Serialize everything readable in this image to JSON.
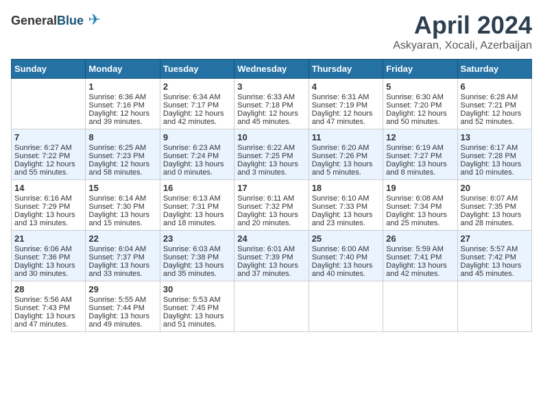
{
  "logo": {
    "general": "General",
    "blue": "Blue"
  },
  "title": "April 2024",
  "location": "Askyaran, Xocali, Azerbaijan",
  "days_of_week": [
    "Sunday",
    "Monday",
    "Tuesday",
    "Wednesday",
    "Thursday",
    "Friday",
    "Saturday"
  ],
  "weeks": [
    [
      null,
      {
        "day": 1,
        "sunrise": "Sunrise: 6:36 AM",
        "sunset": "Sunset: 7:16 PM",
        "daylight": "Daylight: 12 hours and 39 minutes."
      },
      {
        "day": 2,
        "sunrise": "Sunrise: 6:34 AM",
        "sunset": "Sunset: 7:17 PM",
        "daylight": "Daylight: 12 hours and 42 minutes."
      },
      {
        "day": 3,
        "sunrise": "Sunrise: 6:33 AM",
        "sunset": "Sunset: 7:18 PM",
        "daylight": "Daylight: 12 hours and 45 minutes."
      },
      {
        "day": 4,
        "sunrise": "Sunrise: 6:31 AM",
        "sunset": "Sunset: 7:19 PM",
        "daylight": "Daylight: 12 hours and 47 minutes."
      },
      {
        "day": 5,
        "sunrise": "Sunrise: 6:30 AM",
        "sunset": "Sunset: 7:20 PM",
        "daylight": "Daylight: 12 hours and 50 minutes."
      },
      {
        "day": 6,
        "sunrise": "Sunrise: 6:28 AM",
        "sunset": "Sunset: 7:21 PM",
        "daylight": "Daylight: 12 hours and 52 minutes."
      }
    ],
    [
      {
        "day": 7,
        "sunrise": "Sunrise: 6:27 AM",
        "sunset": "Sunset: 7:22 PM",
        "daylight": "Daylight: 12 hours and 55 minutes."
      },
      {
        "day": 8,
        "sunrise": "Sunrise: 6:25 AM",
        "sunset": "Sunset: 7:23 PM",
        "daylight": "Daylight: 12 hours and 58 minutes."
      },
      {
        "day": 9,
        "sunrise": "Sunrise: 6:23 AM",
        "sunset": "Sunset: 7:24 PM",
        "daylight": "Daylight: 13 hours and 0 minutes."
      },
      {
        "day": 10,
        "sunrise": "Sunrise: 6:22 AM",
        "sunset": "Sunset: 7:25 PM",
        "daylight": "Daylight: 13 hours and 3 minutes."
      },
      {
        "day": 11,
        "sunrise": "Sunrise: 6:20 AM",
        "sunset": "Sunset: 7:26 PM",
        "daylight": "Daylight: 13 hours and 5 minutes."
      },
      {
        "day": 12,
        "sunrise": "Sunrise: 6:19 AM",
        "sunset": "Sunset: 7:27 PM",
        "daylight": "Daylight: 13 hours and 8 minutes."
      },
      {
        "day": 13,
        "sunrise": "Sunrise: 6:17 AM",
        "sunset": "Sunset: 7:28 PM",
        "daylight": "Daylight: 13 hours and 10 minutes."
      }
    ],
    [
      {
        "day": 14,
        "sunrise": "Sunrise: 6:16 AM",
        "sunset": "Sunset: 7:29 PM",
        "daylight": "Daylight: 13 hours and 13 minutes."
      },
      {
        "day": 15,
        "sunrise": "Sunrise: 6:14 AM",
        "sunset": "Sunset: 7:30 PM",
        "daylight": "Daylight: 13 hours and 15 minutes."
      },
      {
        "day": 16,
        "sunrise": "Sunrise: 6:13 AM",
        "sunset": "Sunset: 7:31 PM",
        "daylight": "Daylight: 13 hours and 18 minutes."
      },
      {
        "day": 17,
        "sunrise": "Sunrise: 6:11 AM",
        "sunset": "Sunset: 7:32 PM",
        "daylight": "Daylight: 13 hours and 20 minutes."
      },
      {
        "day": 18,
        "sunrise": "Sunrise: 6:10 AM",
        "sunset": "Sunset: 7:33 PM",
        "daylight": "Daylight: 13 hours and 23 minutes."
      },
      {
        "day": 19,
        "sunrise": "Sunrise: 6:08 AM",
        "sunset": "Sunset: 7:34 PM",
        "daylight": "Daylight: 13 hours and 25 minutes."
      },
      {
        "day": 20,
        "sunrise": "Sunrise: 6:07 AM",
        "sunset": "Sunset: 7:35 PM",
        "daylight": "Daylight: 13 hours and 28 minutes."
      }
    ],
    [
      {
        "day": 21,
        "sunrise": "Sunrise: 6:06 AM",
        "sunset": "Sunset: 7:36 PM",
        "daylight": "Daylight: 13 hours and 30 minutes."
      },
      {
        "day": 22,
        "sunrise": "Sunrise: 6:04 AM",
        "sunset": "Sunset: 7:37 PM",
        "daylight": "Daylight: 13 hours and 33 minutes."
      },
      {
        "day": 23,
        "sunrise": "Sunrise: 6:03 AM",
        "sunset": "Sunset: 7:38 PM",
        "daylight": "Daylight: 13 hours and 35 minutes."
      },
      {
        "day": 24,
        "sunrise": "Sunrise: 6:01 AM",
        "sunset": "Sunset: 7:39 PM",
        "daylight": "Daylight: 13 hours and 37 minutes."
      },
      {
        "day": 25,
        "sunrise": "Sunrise: 6:00 AM",
        "sunset": "Sunset: 7:40 PM",
        "daylight": "Daylight: 13 hours and 40 minutes."
      },
      {
        "day": 26,
        "sunrise": "Sunrise: 5:59 AM",
        "sunset": "Sunset: 7:41 PM",
        "daylight": "Daylight: 13 hours and 42 minutes."
      },
      {
        "day": 27,
        "sunrise": "Sunrise: 5:57 AM",
        "sunset": "Sunset: 7:42 PM",
        "daylight": "Daylight: 13 hours and 45 minutes."
      }
    ],
    [
      {
        "day": 28,
        "sunrise": "Sunrise: 5:56 AM",
        "sunset": "Sunset: 7:43 PM",
        "daylight": "Daylight: 13 hours and 47 minutes."
      },
      {
        "day": 29,
        "sunrise": "Sunrise: 5:55 AM",
        "sunset": "Sunset: 7:44 PM",
        "daylight": "Daylight: 13 hours and 49 minutes."
      },
      {
        "day": 30,
        "sunrise": "Sunrise: 5:53 AM",
        "sunset": "Sunset: 7:45 PM",
        "daylight": "Daylight: 13 hours and 51 minutes."
      },
      null,
      null,
      null,
      null
    ]
  ]
}
